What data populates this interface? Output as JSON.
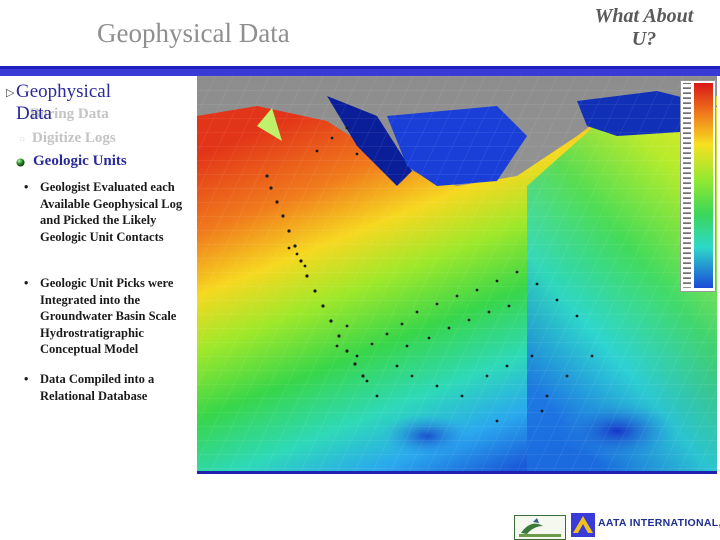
{
  "header": {
    "title": "Geophysical Data",
    "what_about_line1": "What About",
    "what_about_line2": "U?"
  },
  "nav": {
    "main_line1": "Geophysical",
    "main_line2": "Data",
    "faded_item1": "Boring Data",
    "faded_item2": "Digitize Logs",
    "current": "Geologic Units"
  },
  "points": [
    "Geologist Evaluated each Available Geophysical Log and Picked the Likely Geologic Unit Contacts",
    "Geologic Unit Picks were Integrated into the Groundwater Basin Scale Hydrostratigraphic Conceptual Model",
    "Data Compiled into a Relational Database"
  ],
  "colors": {
    "title": "#8f8f8f",
    "nav": "#2a2a9a",
    "bar": "#3a3ad8"
  },
  "icons": {
    "main_bullet": "triangle-arrow-icon",
    "faded_bullet": "hollow-bullet-icon",
    "unit_bullet": "shaded-sphere-icon"
  },
  "logos": {
    "aata": "AATA INTERNATIONAL, INC."
  }
}
